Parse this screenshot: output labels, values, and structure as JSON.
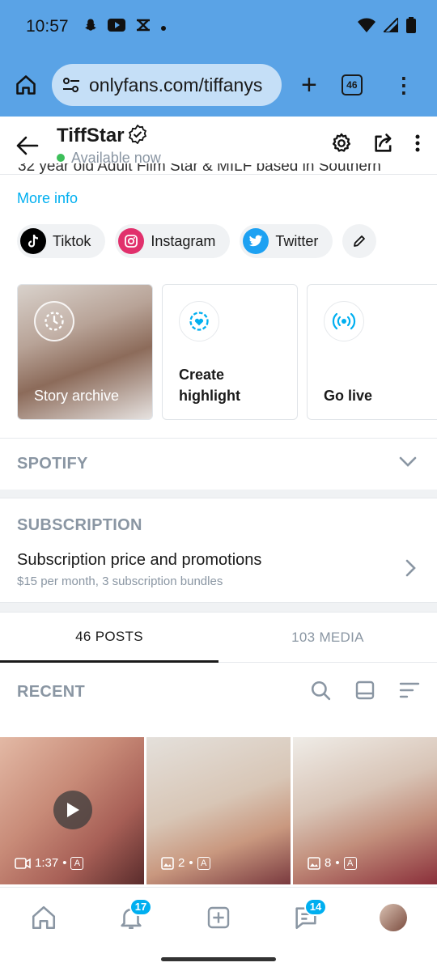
{
  "status_bar": {
    "time": "10:57",
    "left_icons": [
      "snapchat-icon",
      "youtube-icon",
      "capcut-icon",
      "dot-icon"
    ],
    "right_icons": [
      "wifi-icon",
      "signal-icon",
      "battery-icon"
    ]
  },
  "browser": {
    "url": "onlyfans.com/tiffanys",
    "tab_count": "46"
  },
  "profile": {
    "name": "TiffStar",
    "status": "Available now",
    "status_color": "#3dbf5a",
    "bio_truncated": "32 year old Adult Film Star & MILF based in Southern",
    "more_info": "More info"
  },
  "social_links": [
    {
      "label": "Tiktok",
      "icon": "tiktok-icon"
    },
    {
      "label": "Instagram",
      "icon": "instagram-icon"
    },
    {
      "label": "Twitter",
      "icon": "twitter-icon"
    }
  ],
  "highlights": [
    {
      "label": "Story archive"
    },
    {
      "label": "Create highlight"
    },
    {
      "label": "Go live"
    }
  ],
  "spotify": {
    "title": "SPOTIFY"
  },
  "subscription": {
    "title": "SUBSCRIPTION",
    "row_title": "Subscription price and promotions",
    "row_detail": "$15 per month, 3 subscription bundles"
  },
  "post_tabs": [
    {
      "label": "46 POSTS",
      "active": true
    },
    {
      "label": "103 MEDIA",
      "active": false
    }
  ],
  "recent": {
    "title": "RECENT"
  },
  "media": [
    {
      "type": "video",
      "count": "1:37",
      "badge": "A"
    },
    {
      "type": "image",
      "count": "2",
      "badge": "A"
    },
    {
      "type": "image",
      "count": "8",
      "badge": "A"
    }
  ],
  "bottom_nav": {
    "notifications_badge": "17",
    "messages_badge": "14"
  },
  "colors": {
    "accent": "#00aff0",
    "browser_bar": "#5aa3e6"
  }
}
